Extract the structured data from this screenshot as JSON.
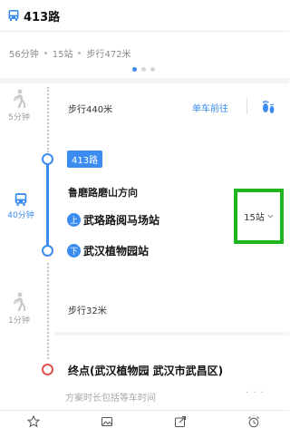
{
  "header": {
    "title": "413路",
    "icon": "bus-icon"
  },
  "summary": {
    "duration": "56分钟",
    "stops": "15站",
    "walk": "步行472米"
  },
  "pager": {
    "count": 3,
    "active": 0
  },
  "walk1": {
    "time": "5分钟",
    "text": "步行440米",
    "board_link": "单车前往",
    "icon": "walk-figure-icon"
  },
  "bus": {
    "duration": "40分钟",
    "route": "413路",
    "direction": "鲁磨路磨山方向",
    "board_badge": "上",
    "board_stop": "武珞路阅马场站",
    "alight_badge": "下",
    "alight_stop": "武汉植物园站",
    "stops_count": "15站"
  },
  "walk2": {
    "time": "1分钟",
    "text": "步行32米"
  },
  "end": {
    "label": "终点(武汉植物园  武汉市武昌区)",
    "note": "方案时长包括等车时间",
    "more": "· · ·"
  },
  "colors": {
    "accent": "#3b8cf0",
    "end_ring": "#e0524c",
    "highlight_box": "#1fb51f"
  }
}
